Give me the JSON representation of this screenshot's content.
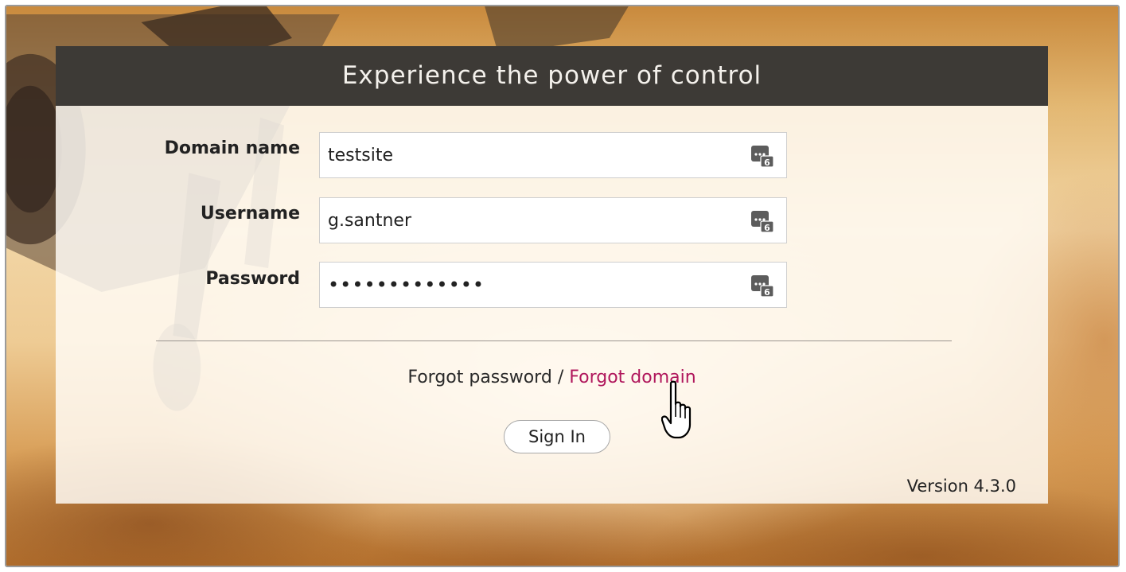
{
  "header": {
    "title": "Experience the power of control"
  },
  "form": {
    "domain": {
      "label": "Domain name",
      "value": "testsite",
      "icon": "keyboard-icon"
    },
    "username": {
      "label": "Username",
      "value": "g.santner",
      "icon": "keyboard-icon"
    },
    "password": {
      "label": "Password",
      "value": "•••••••••••••",
      "icon": "keyboard-icon"
    }
  },
  "links": {
    "forgot_password": "Forgot password",
    "separator": "/",
    "forgot_domain": "Forgot domain"
  },
  "signin_label": "Sign In",
  "version": "Version 4.3.0",
  "colors": {
    "header_bg": "#3d3a36",
    "header_text": "#f4f1ec",
    "link_accent": "#b0175c"
  }
}
